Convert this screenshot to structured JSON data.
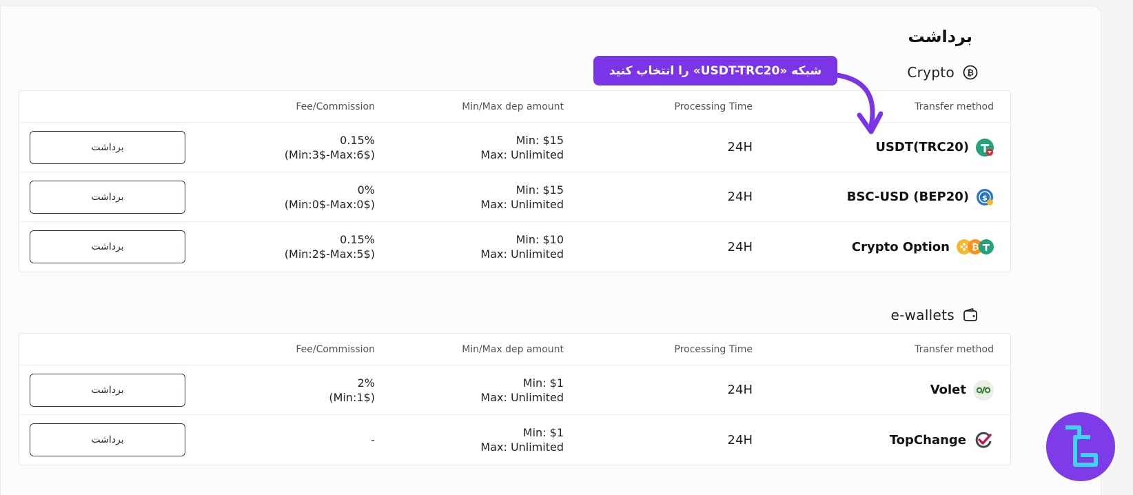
{
  "page": {
    "title": "برداشت"
  },
  "annotation": {
    "callout_text": "شبکه «USDT-TRC20» را انتخاب کنید"
  },
  "headers": {
    "transfer_method": "Transfer method",
    "processing_time": "Processing Time",
    "minmax": "Min/Max dep amount",
    "fee": "Fee/Commission"
  },
  "crypto": {
    "title": "Crypto",
    "icon": "bitcoin-circle-icon",
    "rows": [
      {
        "method": "USDT(TRC20)",
        "icon": "tether-tron-icon",
        "time": "24H",
        "min": "Min: $15",
        "max": "Max: Unlimited",
        "fee": "0.15%",
        "fee_range": "(Min:3$-Max:6$)",
        "action": "برداشت"
      },
      {
        "method": "BSC-USD (BEP20)",
        "icon": "bsc-usd-icon",
        "time": "24H",
        "min": "Min: $15",
        "max": "Max: Unlimited",
        "fee": "0%",
        "fee_range": "(Min:0$-Max:0$)",
        "action": "برداشت"
      },
      {
        "method": "Crypto Option",
        "icon": "crypto-coins-icon",
        "time": "24H",
        "min": "Min: $10",
        "max": "Max: Unlimited",
        "fee": "0.15%",
        "fee_range": "(Min:2$-Max:5$)",
        "action": "برداشت"
      }
    ]
  },
  "ewallets": {
    "title": "e-wallets",
    "icon": "wallet-icon",
    "rows": [
      {
        "method": "Volet",
        "icon": "volet-icon",
        "time": "24H",
        "min": "Min: $1",
        "max": "Max: Unlimited",
        "fee": "2%",
        "fee_range": "(Min:1$)",
        "action": "برداشت"
      },
      {
        "method": "TopChange",
        "icon": "topchange-icon",
        "time": "24H",
        "min": "Min: $1",
        "max": "Max: Unlimited",
        "fee": "-",
        "fee_range": "",
        "action": "برداشت"
      }
    ]
  },
  "colors": {
    "accent": "#7b35e6",
    "tether": "#26a17b",
    "tron_badge": "#e0262b",
    "usdc_blue": "#2775ca",
    "bnb": "#f3ba2f",
    "btc": "#f7931a",
    "volet_green": "#2e7d32",
    "topchange_red": "#c2185b"
  }
}
